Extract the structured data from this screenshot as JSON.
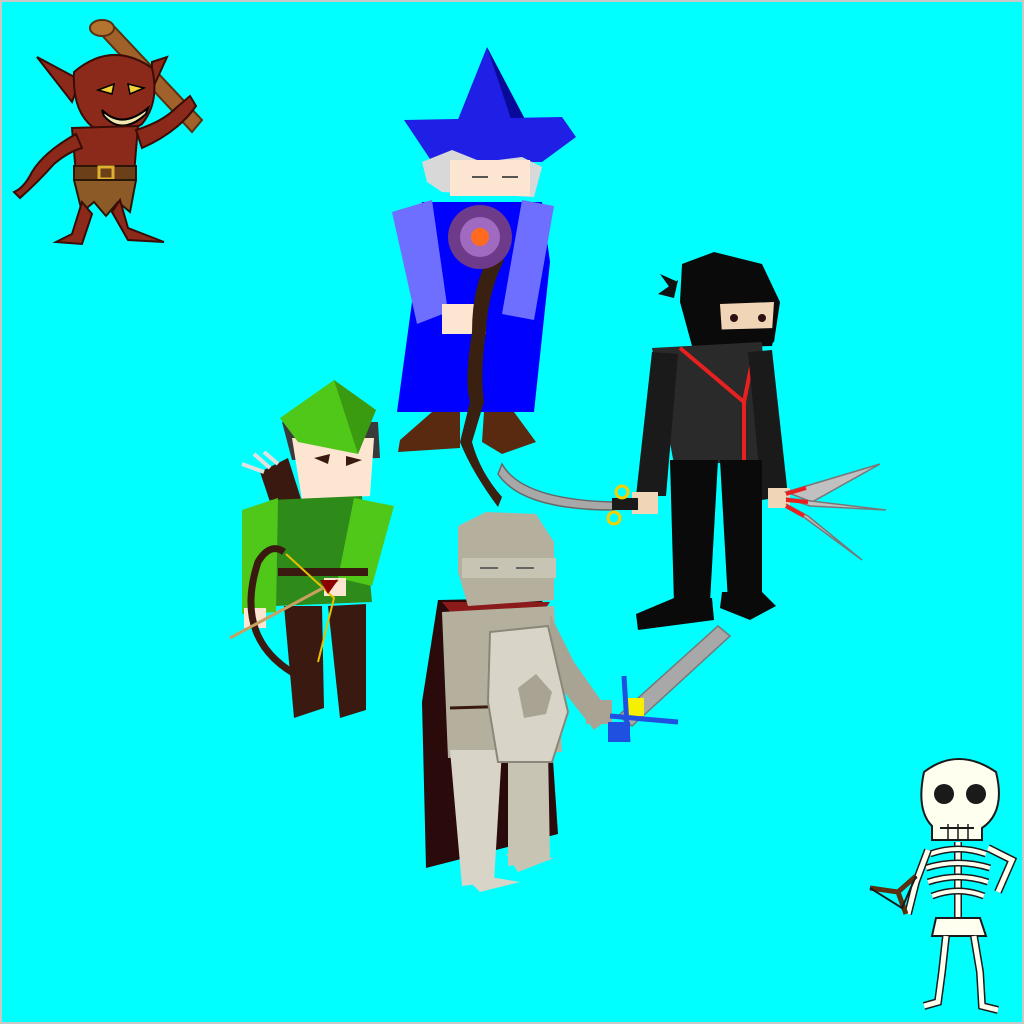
{
  "scene": {
    "background": "#00FFFF",
    "border_color": "#C8C8C8"
  },
  "party": [
    {
      "id": "wizard",
      "role": "Wizard",
      "weapon": "staff-icon",
      "hat_color": "#1F1FE6",
      "robe_color": "#0000FF"
    },
    {
      "id": "ninja",
      "role": "Ninja",
      "weapon": "kunai-icon",
      "accent_color": "#E82020"
    },
    {
      "id": "archer",
      "role": "Archer",
      "weapon": "bow-icon",
      "hat_color": "#4FC81A",
      "tunic_color": "#2E8B1A"
    },
    {
      "id": "knight",
      "role": "Knight",
      "weapon": "sword-icon",
      "armor_color": "#B5B09E",
      "cape_color": "#2A0A0A"
    }
  ],
  "enemies": [
    {
      "id": "goblin",
      "role": "Goblin",
      "weapon": "club-icon",
      "skin_color": "#8B2A1A"
    },
    {
      "id": "skeleton",
      "role": "Skeleton",
      "weapon": "slingshot-icon",
      "bone_color": "#FFFFF0"
    }
  ]
}
